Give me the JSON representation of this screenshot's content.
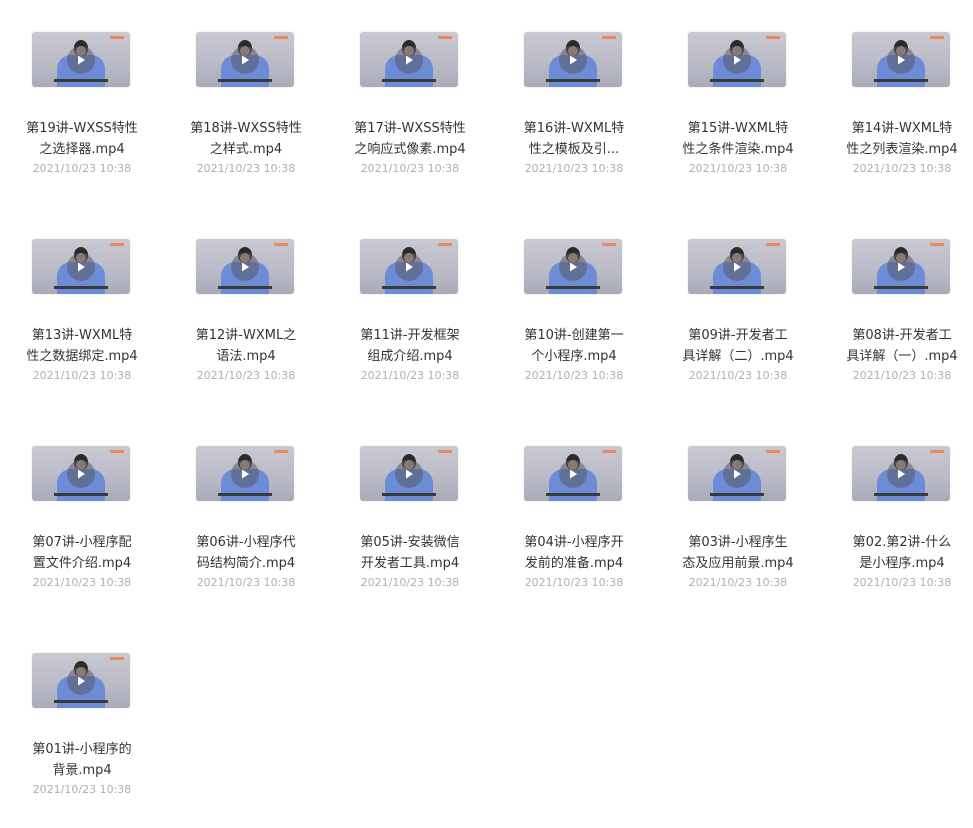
{
  "files": [
    {
      "line1": "第19讲-WXSS特性",
      "line2": "之选择器.mp4",
      "date": "2021/10/23 10:38"
    },
    {
      "line1": "第18讲-WXSS特性",
      "line2": "之样式.mp4",
      "date": "2021/10/23 10:38"
    },
    {
      "line1": "第17讲-WXSS特性",
      "line2": "之响应式像素.mp4",
      "date": "2021/10/23 10:38"
    },
    {
      "line1": "第16讲-WXML特",
      "line2": "性之模板及引...",
      "date": "2021/10/23 10:38"
    },
    {
      "line1": "第15讲-WXML特",
      "line2": "性之条件渲染.mp4",
      "date": "2021/10/23 10:38"
    },
    {
      "line1": "第14讲-WXML特",
      "line2": "性之列表渲染.mp4",
      "date": "2021/10/23 10:38"
    },
    {
      "line1": "第13讲-WXML特",
      "line2": "性之数据绑定.mp4",
      "date": "2021/10/23 10:38"
    },
    {
      "line1": "第12讲-WXML之",
      "line2": "语法.mp4",
      "date": "2021/10/23 10:38"
    },
    {
      "line1": "第11讲-开发框架",
      "line2": "组成介绍.mp4",
      "date": "2021/10/23 10:38"
    },
    {
      "line1": "第10讲-创建第一",
      "line2": "个小程序.mp4",
      "date": "2021/10/23 10:38"
    },
    {
      "line1": "第09讲-开发者工",
      "line2": "具详解（二）.mp4",
      "date": "2021/10/23 10:38"
    },
    {
      "line1": "第08讲-开发者工",
      "line2": "具详解（一）.mp4",
      "date": "2021/10/23 10:38"
    },
    {
      "line1": "第07讲-小程序配",
      "line2": "置文件介绍.mp4",
      "date": "2021/10/23 10:38"
    },
    {
      "line1": "第06讲-小程序代",
      "line2": "码结构简介.mp4",
      "date": "2021/10/23 10:38"
    },
    {
      "line1": "第05讲-安装微信",
      "line2": "开发者工具.mp4",
      "date": "2021/10/23 10:38"
    },
    {
      "line1": "第04讲-小程序开",
      "line2": "发前的准备.mp4",
      "date": "2021/10/23 10:38"
    },
    {
      "line1": "第03讲-小程序生",
      "line2": "态及应用前景.mp4",
      "date": "2021/10/23 10:38"
    },
    {
      "line1": "第02.第2讲-什么",
      "line2": "是小程序.mp4",
      "date": "2021/10/23 10:38"
    },
    {
      "line1": "第01讲-小程序的",
      "line2": "背景.mp4",
      "date": "2021/10/23 10:38"
    }
  ],
  "icons": {
    "play": "play-icon"
  },
  "colors": {
    "thumb_bg": "#bdbec9",
    "shirt": "#6c8cd8",
    "text": "#333333",
    "date": "#b0b0b0"
  }
}
